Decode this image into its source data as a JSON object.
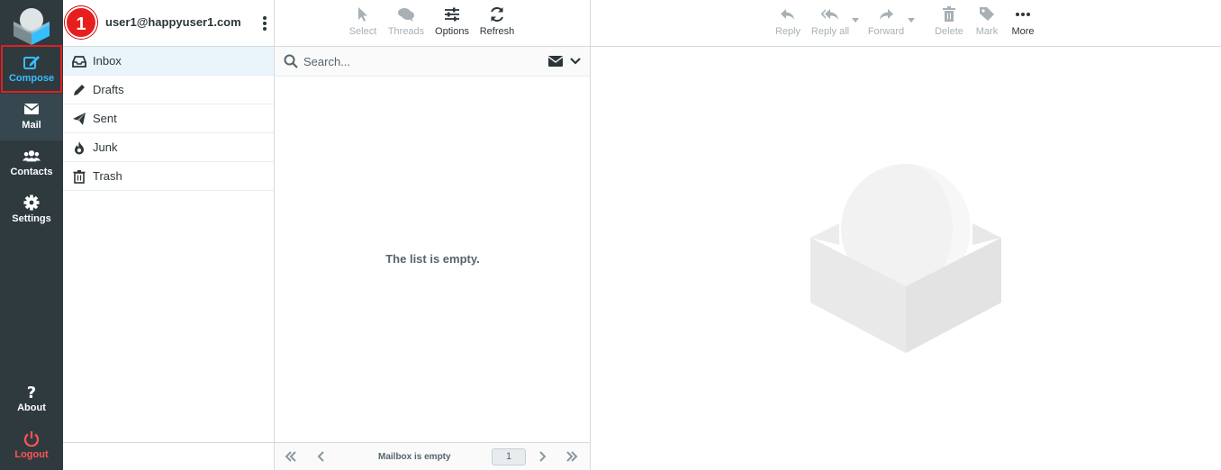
{
  "nav": {
    "compose": "Compose",
    "mail": "Mail",
    "contacts": "Contacts",
    "settings": "Settings",
    "about": "About",
    "logout": "Logout"
  },
  "annotation": {
    "step_number": "1"
  },
  "account": {
    "user": "user1@happyuser1.com"
  },
  "folders": [
    {
      "label": "Inbox",
      "icon": "inbox-icon"
    },
    {
      "label": "Drafts",
      "icon": "pencil-icon"
    },
    {
      "label": "Sent",
      "icon": "paper-plane-icon"
    },
    {
      "label": "Junk",
      "icon": "fire-icon"
    },
    {
      "label": "Trash",
      "icon": "trash-icon"
    }
  ],
  "list_toolbar": {
    "select": "Select",
    "threads": "Threads",
    "options": "Options",
    "refresh": "Refresh"
  },
  "search": {
    "placeholder": "Search..."
  },
  "list": {
    "empty_message": "The list is empty.",
    "status": "Mailbox is empty",
    "page": "1"
  },
  "message_toolbar": {
    "reply": "Reply",
    "reply_all": "Reply all",
    "forward": "Forward",
    "delete": "Delete",
    "mark": "Mark",
    "more": "More"
  },
  "colors": {
    "nav_bg": "#2f3a3f",
    "accent": "#37beff",
    "logout": "#ff5555",
    "highlight_border": "#e02020",
    "selected_folder": "#eaf5fb"
  }
}
